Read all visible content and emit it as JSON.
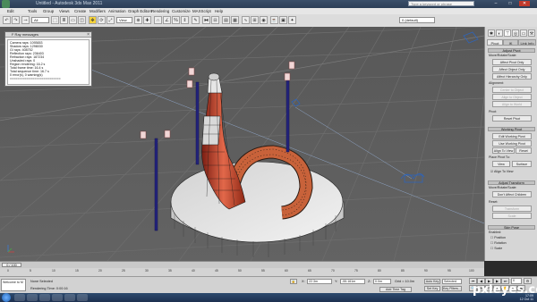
{
  "window": {
    "title": "Untitled - Autodesk 3ds Max 2011",
    "search_placeholder": "Type a keyword or phrase",
    "controls": [
      "–",
      "□",
      "✕"
    ]
  },
  "menu": [
    "Edit",
    "Tools",
    "Group",
    "Views",
    "Create",
    "Modifiers",
    "Animation",
    "Graph Editors",
    "Rendering",
    "Customize",
    "MAXScript",
    "Help"
  ],
  "toolbar": {
    "selection_filter": "All",
    "reference_coord": "View",
    "named_set": "0 (default)"
  },
  "script_window": {
    "title": "F Ray messages",
    "lines": [
      "Camera rays: 1093653",
      "Shadow rays: 1298030",
      "GI rays: 408752",
      "Reflection rays: 236403",
      "Refraction rays: 187234",
      "Unshaded rays: 0",
      "Region rendering: 16.2 s",
      "Total frame time: 16.4 s",
      "Total sequence time: 16.7 s",
      "0 error(s), 0 warning(s)",
      "==========================="
    ]
  },
  "command_panel": {
    "tabs": [
      "Pivot",
      "IK",
      "Link Info"
    ],
    "rollouts": {
      "adjust_pivot": "Adjust Pivot",
      "move_rotate_scale": "Move/Rotate/Scale:",
      "affect_pivot_only": "Affect Pivot Only",
      "affect_object_only": "Affect Object Only",
      "affect_hierarchy_only": "Affect Hierarchy Only",
      "alignment": "Alignment:",
      "center_to_object": "Center to Object",
      "align_to_object": "Align to Object",
      "align_to_world": "Align to World",
      "pivot": "Pivot:",
      "reset_pivot": "Reset Pivot",
      "working_pivot": "Working Pivot",
      "edit_working_pivot": "Edit Working Pivot",
      "use_working_pivot": "Use Working Pivot",
      "align_to_view": "Align To View",
      "reset": "Reset",
      "place_pivot_to": "Place Pivot To:",
      "view": "View",
      "surface": "Surface",
      "align_to_view_chk": "Align To View",
      "adjust_transform": "Adjust Transform",
      "dont_affect_children": "Don't Affect Children",
      "reset_group": "Reset:",
      "transform": "Transform",
      "scale": "Scale",
      "skin_pose": "Skin Pose",
      "enabled": "Enabled:",
      "position": "Position",
      "rotation": "Rotation",
      "scale_chk": "Scale"
    }
  },
  "timeline": {
    "slider": "0 / 100",
    "ticks": [
      "0",
      "5",
      "10",
      "15",
      "20",
      "25",
      "30",
      "35",
      "40",
      "45",
      "50",
      "55",
      "60",
      "65",
      "70",
      "75",
      "80",
      "85",
      "90",
      "95",
      "100"
    ]
  },
  "status": {
    "script_listener": "Welcome to M",
    "selection": "None Selected",
    "prompt": "Rendering Time: 0:00:16",
    "x_label": "X:",
    "x_value": "22.3m",
    "y_label": "Y:",
    "y_value": "-55.161m",
    "z_label": "Z:",
    "z_value": "0.0m",
    "grid": "Grid = 10.0m",
    "add_time_tag": "Add Time Tag",
    "auto_key": "Auto Key",
    "set_key": "Set Key",
    "selected": "Selected",
    "key_filters": "Key Filters...",
    "frame": "0"
  },
  "taskbar": {
    "time": "17:09",
    "date": "12 Oct 11",
    "watermark": "pxleyes.com"
  },
  "colors": {
    "viewport_bg": "#5c5c5c",
    "grid": "#6d6d6d",
    "mesh_wire": "#2a2a2a",
    "orange_selection": "#d35a2a",
    "lamp_post": "#23237a"
  }
}
